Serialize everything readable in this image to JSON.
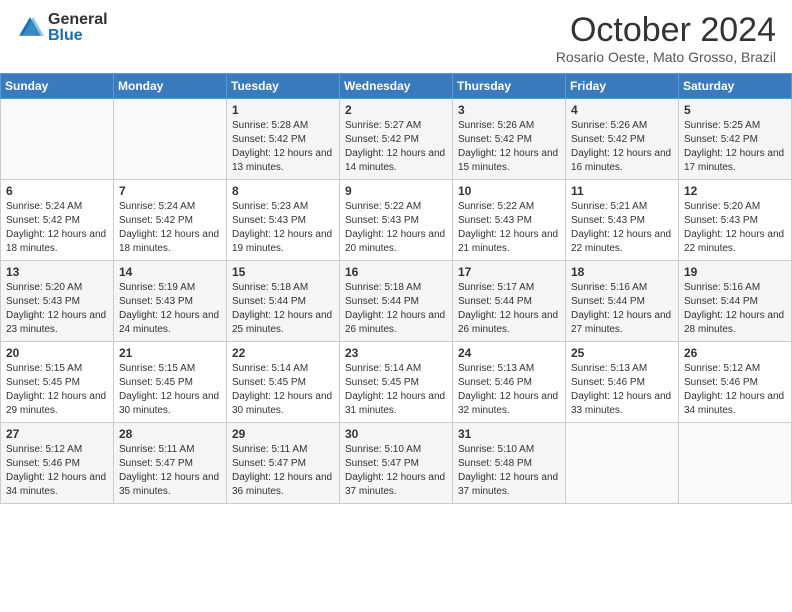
{
  "header": {
    "logo_general": "General",
    "logo_blue": "Blue",
    "month_title": "October 2024",
    "location": "Rosario Oeste, Mato Grosso, Brazil"
  },
  "days_of_week": [
    "Sunday",
    "Monday",
    "Tuesday",
    "Wednesday",
    "Thursday",
    "Friday",
    "Saturday"
  ],
  "weeks": [
    [
      {
        "day": "",
        "sunrise": "",
        "sunset": "",
        "daylight": ""
      },
      {
        "day": "",
        "sunrise": "",
        "sunset": "",
        "daylight": ""
      },
      {
        "day": "1",
        "sunrise": "Sunrise: 5:28 AM",
        "sunset": "Sunset: 5:42 PM",
        "daylight": "Daylight: 12 hours and 13 minutes."
      },
      {
        "day": "2",
        "sunrise": "Sunrise: 5:27 AM",
        "sunset": "Sunset: 5:42 PM",
        "daylight": "Daylight: 12 hours and 14 minutes."
      },
      {
        "day": "3",
        "sunrise": "Sunrise: 5:26 AM",
        "sunset": "Sunset: 5:42 PM",
        "daylight": "Daylight: 12 hours and 15 minutes."
      },
      {
        "day": "4",
        "sunrise": "Sunrise: 5:26 AM",
        "sunset": "Sunset: 5:42 PM",
        "daylight": "Daylight: 12 hours and 16 minutes."
      },
      {
        "day": "5",
        "sunrise": "Sunrise: 5:25 AM",
        "sunset": "Sunset: 5:42 PM",
        "daylight": "Daylight: 12 hours and 17 minutes."
      }
    ],
    [
      {
        "day": "6",
        "sunrise": "Sunrise: 5:24 AM",
        "sunset": "Sunset: 5:42 PM",
        "daylight": "Daylight: 12 hours and 18 minutes."
      },
      {
        "day": "7",
        "sunrise": "Sunrise: 5:24 AM",
        "sunset": "Sunset: 5:42 PM",
        "daylight": "Daylight: 12 hours and 18 minutes."
      },
      {
        "day": "8",
        "sunrise": "Sunrise: 5:23 AM",
        "sunset": "Sunset: 5:43 PM",
        "daylight": "Daylight: 12 hours and 19 minutes."
      },
      {
        "day": "9",
        "sunrise": "Sunrise: 5:22 AM",
        "sunset": "Sunset: 5:43 PM",
        "daylight": "Daylight: 12 hours and 20 minutes."
      },
      {
        "day": "10",
        "sunrise": "Sunrise: 5:22 AM",
        "sunset": "Sunset: 5:43 PM",
        "daylight": "Daylight: 12 hours and 21 minutes."
      },
      {
        "day": "11",
        "sunrise": "Sunrise: 5:21 AM",
        "sunset": "Sunset: 5:43 PM",
        "daylight": "Daylight: 12 hours and 22 minutes."
      },
      {
        "day": "12",
        "sunrise": "Sunrise: 5:20 AM",
        "sunset": "Sunset: 5:43 PM",
        "daylight": "Daylight: 12 hours and 22 minutes."
      }
    ],
    [
      {
        "day": "13",
        "sunrise": "Sunrise: 5:20 AM",
        "sunset": "Sunset: 5:43 PM",
        "daylight": "Daylight: 12 hours and 23 minutes."
      },
      {
        "day": "14",
        "sunrise": "Sunrise: 5:19 AM",
        "sunset": "Sunset: 5:43 PM",
        "daylight": "Daylight: 12 hours and 24 minutes."
      },
      {
        "day": "15",
        "sunrise": "Sunrise: 5:18 AM",
        "sunset": "Sunset: 5:44 PM",
        "daylight": "Daylight: 12 hours and 25 minutes."
      },
      {
        "day": "16",
        "sunrise": "Sunrise: 5:18 AM",
        "sunset": "Sunset: 5:44 PM",
        "daylight": "Daylight: 12 hours and 26 minutes."
      },
      {
        "day": "17",
        "sunrise": "Sunrise: 5:17 AM",
        "sunset": "Sunset: 5:44 PM",
        "daylight": "Daylight: 12 hours and 26 minutes."
      },
      {
        "day": "18",
        "sunrise": "Sunrise: 5:16 AM",
        "sunset": "Sunset: 5:44 PM",
        "daylight": "Daylight: 12 hours and 27 minutes."
      },
      {
        "day": "19",
        "sunrise": "Sunrise: 5:16 AM",
        "sunset": "Sunset: 5:44 PM",
        "daylight": "Daylight: 12 hours and 28 minutes."
      }
    ],
    [
      {
        "day": "20",
        "sunrise": "Sunrise: 5:15 AM",
        "sunset": "Sunset: 5:45 PM",
        "daylight": "Daylight: 12 hours and 29 minutes."
      },
      {
        "day": "21",
        "sunrise": "Sunrise: 5:15 AM",
        "sunset": "Sunset: 5:45 PM",
        "daylight": "Daylight: 12 hours and 30 minutes."
      },
      {
        "day": "22",
        "sunrise": "Sunrise: 5:14 AM",
        "sunset": "Sunset: 5:45 PM",
        "daylight": "Daylight: 12 hours and 30 minutes."
      },
      {
        "day": "23",
        "sunrise": "Sunrise: 5:14 AM",
        "sunset": "Sunset: 5:45 PM",
        "daylight": "Daylight: 12 hours and 31 minutes."
      },
      {
        "day": "24",
        "sunrise": "Sunrise: 5:13 AM",
        "sunset": "Sunset: 5:46 PM",
        "daylight": "Daylight: 12 hours and 32 minutes."
      },
      {
        "day": "25",
        "sunrise": "Sunrise: 5:13 AM",
        "sunset": "Sunset: 5:46 PM",
        "daylight": "Daylight: 12 hours and 33 minutes."
      },
      {
        "day": "26",
        "sunrise": "Sunrise: 5:12 AM",
        "sunset": "Sunset: 5:46 PM",
        "daylight": "Daylight: 12 hours and 34 minutes."
      }
    ],
    [
      {
        "day": "27",
        "sunrise": "Sunrise: 5:12 AM",
        "sunset": "Sunset: 5:46 PM",
        "daylight": "Daylight: 12 hours and 34 minutes."
      },
      {
        "day": "28",
        "sunrise": "Sunrise: 5:11 AM",
        "sunset": "Sunset: 5:47 PM",
        "daylight": "Daylight: 12 hours and 35 minutes."
      },
      {
        "day": "29",
        "sunrise": "Sunrise: 5:11 AM",
        "sunset": "Sunset: 5:47 PM",
        "daylight": "Daylight: 12 hours and 36 minutes."
      },
      {
        "day": "30",
        "sunrise": "Sunrise: 5:10 AM",
        "sunset": "Sunset: 5:47 PM",
        "daylight": "Daylight: 12 hours and 37 minutes."
      },
      {
        "day": "31",
        "sunrise": "Sunrise: 5:10 AM",
        "sunset": "Sunset: 5:48 PM",
        "daylight": "Daylight: 12 hours and 37 minutes."
      },
      {
        "day": "",
        "sunrise": "",
        "sunset": "",
        "daylight": ""
      },
      {
        "day": "",
        "sunrise": "",
        "sunset": "",
        "daylight": ""
      }
    ]
  ]
}
